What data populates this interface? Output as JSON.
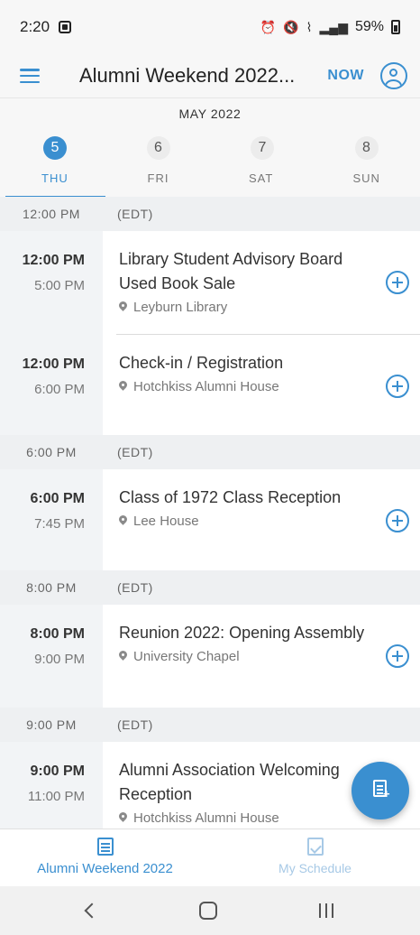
{
  "status_bar": {
    "time": "2:20",
    "battery": "59%"
  },
  "app_bar": {
    "title": "Alumni Weekend 2022...",
    "now_label": "NOW"
  },
  "calendar": {
    "month": "MAY 2022",
    "days": [
      {
        "num": "5",
        "name": "THU",
        "active": true
      },
      {
        "num": "6",
        "name": "FRI",
        "active": false
      },
      {
        "num": "7",
        "name": "SAT",
        "active": false
      },
      {
        "num": "8",
        "name": "SUN",
        "active": false
      }
    ]
  },
  "schedule": {
    "sections": [
      {
        "time": "12:00 PM",
        "tz": "(EDT)",
        "events": [
          {
            "start": "12:00 PM",
            "end": "5:00 PM",
            "title": "Library Student Advisory Board Used Book Sale",
            "location": "Leyburn Library"
          },
          {
            "start": "12:00 PM",
            "end": "6:00 PM",
            "title": "Check-in / Registration",
            "location": "Hotchkiss Alumni House"
          }
        ]
      },
      {
        "time": "6:00 PM",
        "tz": "(EDT)",
        "events": [
          {
            "start": "6:00 PM",
            "end": "7:45 PM",
            "title": "Class of 1972 Class Reception",
            "location": "Lee House"
          }
        ]
      },
      {
        "time": "8:00 PM",
        "tz": "(EDT)",
        "events": [
          {
            "start": "8:00 PM",
            "end": "9:00 PM",
            "title": "Reunion 2022: Opening Assembly",
            "location": "University Chapel"
          }
        ]
      },
      {
        "time": "9:00 PM",
        "tz": "(EDT)",
        "events": [
          {
            "start": "9:00 PM",
            "end": "11:00 PM",
            "title": "Alumni Association Welcoming Reception",
            "location": "Hotchkiss Alumni House"
          }
        ]
      }
    ]
  },
  "bottom_nav": {
    "agenda_label": "Alumni Weekend 2022",
    "my_schedule_label": "My Schedule"
  },
  "colors": {
    "accent": "#3a8fd0",
    "time_column": "#f2f4f6",
    "section_header": "#eef0f2"
  }
}
